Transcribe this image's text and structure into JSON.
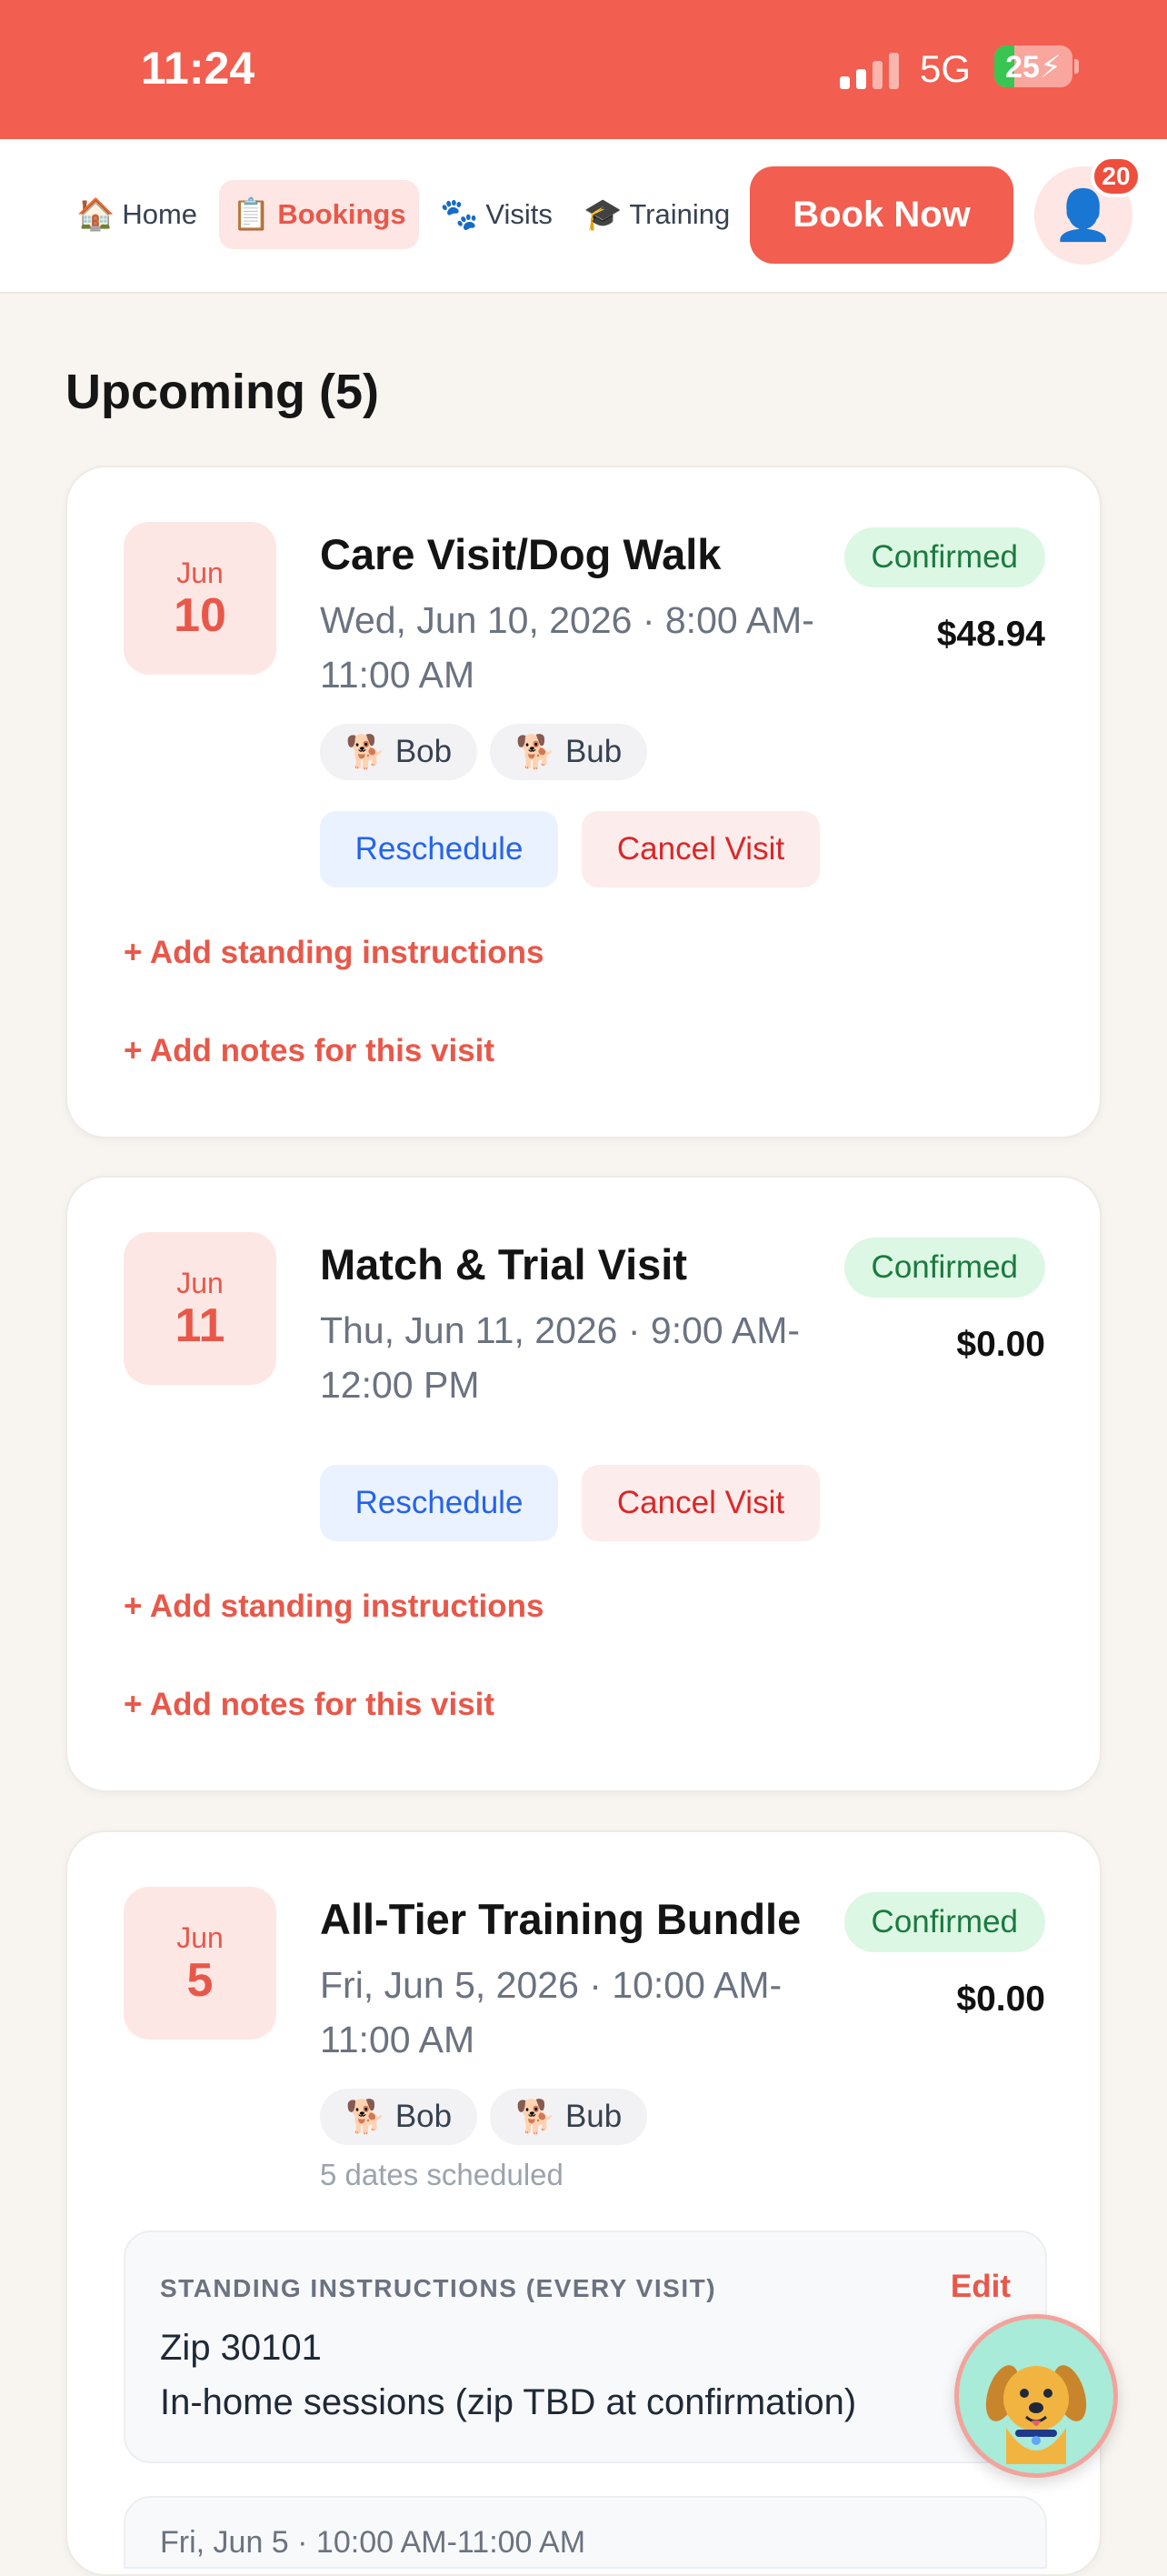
{
  "status_bar": {
    "time": "11:24",
    "network": "5G",
    "battery": "25"
  },
  "nav": {
    "items": [
      {
        "icon": "🏠",
        "label": "Home"
      },
      {
        "icon": "📋",
        "label": "Bookings"
      },
      {
        "icon": "🐾",
        "label": "Visits"
      },
      {
        "icon": "🎓",
        "label": "Training"
      }
    ],
    "active": "Bookings",
    "book_now": "Book Now",
    "notification_count": "20",
    "avatar_icon": "👤"
  },
  "section_title": "Upcoming (5)",
  "bookings": [
    {
      "month": "Jun",
      "day": "10",
      "title": "Care Visit/Dog Walk",
      "when_line1": "Wed, Jun 10, 2026 · 8:00 AM-",
      "when_line2": "11:00 AM",
      "status": "Confirmed",
      "price": "$48.94",
      "pets": [
        "Bob",
        "Bub"
      ],
      "reschedule": "Reschedule",
      "cancel": "Cancel Visit",
      "add_standing": "+ Add standing instructions",
      "add_notes": "+ Add notes for this visit"
    },
    {
      "month": "Jun",
      "day": "11",
      "title": "Match & Trial Visit",
      "when_line1": "Thu, Jun 11, 2026 · 9:00 AM-",
      "when_line2": "12:00 PM",
      "status": "Confirmed",
      "price": "$0.00",
      "reschedule": "Reschedule",
      "cancel": "Cancel Visit",
      "add_standing": "+ Add standing instructions",
      "add_notes": "+ Add notes for this visit"
    },
    {
      "month": "Jun",
      "day": "5",
      "title": "All-Tier Training Bundle",
      "when_line1": "Fri, Jun 5, 2026 · 10:00 AM-",
      "when_line2": "11:00 AM",
      "status": "Confirmed",
      "price": "$0.00",
      "pets": [
        "Bob",
        "Bub"
      ],
      "dates_scheduled": "5 dates scheduled",
      "instructions": {
        "heading": "STANDING INSTRUCTIONS (EVERY VISIT)",
        "edit": "Edit",
        "line1": "Zip 30101",
        "line2": "In-home sessions (zip TBD at confirmation)"
      },
      "next_session_peek": "Fri, Jun 5 · 10:00 AM-11:00 AM"
    }
  ],
  "pet_icon": "🐕"
}
